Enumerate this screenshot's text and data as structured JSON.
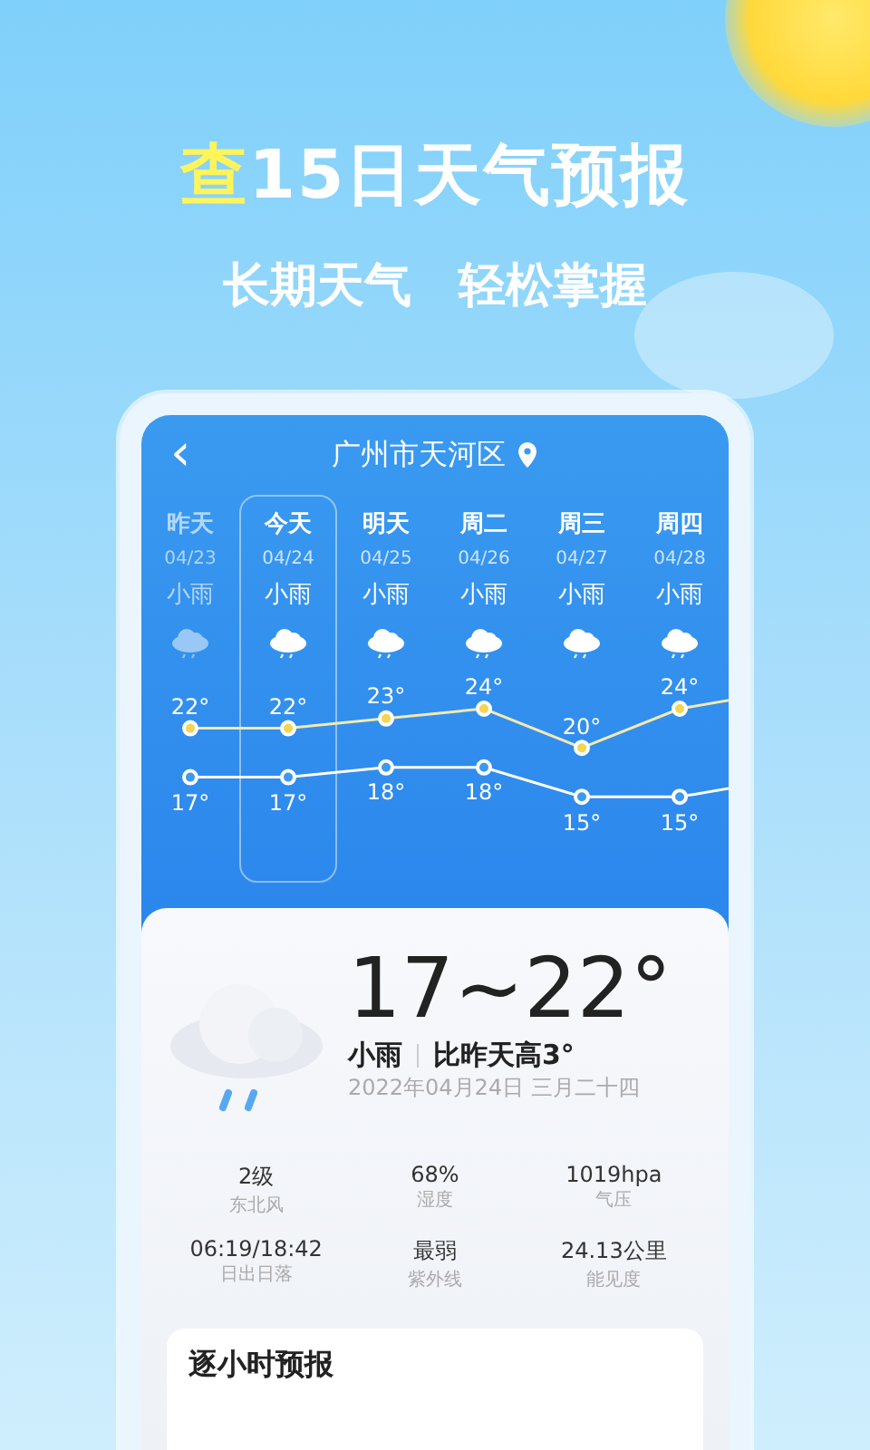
{
  "headline": {
    "highlight": "查",
    "rest": "15日天气预报"
  },
  "subheadline": [
    "长期天气",
    "轻松掌握"
  ],
  "header": {
    "back": "‹",
    "location": "广州市天河区"
  },
  "days": [
    {
      "name": "昨天",
      "date": "04/23",
      "weather": "小雨",
      "high": "22°",
      "low": "17°",
      "past": true,
      "selected": false
    },
    {
      "name": "今天",
      "date": "04/24",
      "weather": "小雨",
      "high": "22°",
      "low": "17°",
      "past": false,
      "selected": true
    },
    {
      "name": "明天",
      "date": "04/25",
      "weather": "小雨",
      "high": "23°",
      "low": "18°",
      "past": false,
      "selected": false
    },
    {
      "name": "周二",
      "date": "04/26",
      "weather": "小雨",
      "high": "24°",
      "low": "18°",
      "past": false,
      "selected": false
    },
    {
      "name": "周三",
      "date": "04/27",
      "weather": "小雨",
      "high": "20°",
      "low": "15°",
      "past": false,
      "selected": false
    },
    {
      "name": "周四",
      "date": "04/28",
      "weather": "小雨",
      "high": "24°",
      "low": "15°",
      "past": false,
      "selected": false
    }
  ],
  "today": {
    "range": "17~22°",
    "weather": "小雨",
    "compare": "比昨天高3°",
    "date": "2022年04月24日  三月二十四"
  },
  "stats": [
    {
      "value": "2级",
      "label": "东北风"
    },
    {
      "value": "68%",
      "label": "湿度"
    },
    {
      "value": "1019hpa",
      "label": "气压"
    },
    {
      "value": "06:19/18:42",
      "label": "日出日落"
    },
    {
      "value": "最弱",
      "label": "紫外线"
    },
    {
      "value": "24.13公里",
      "label": "能见度"
    }
  ],
  "hourly": {
    "title": "逐小时预报"
  }
}
